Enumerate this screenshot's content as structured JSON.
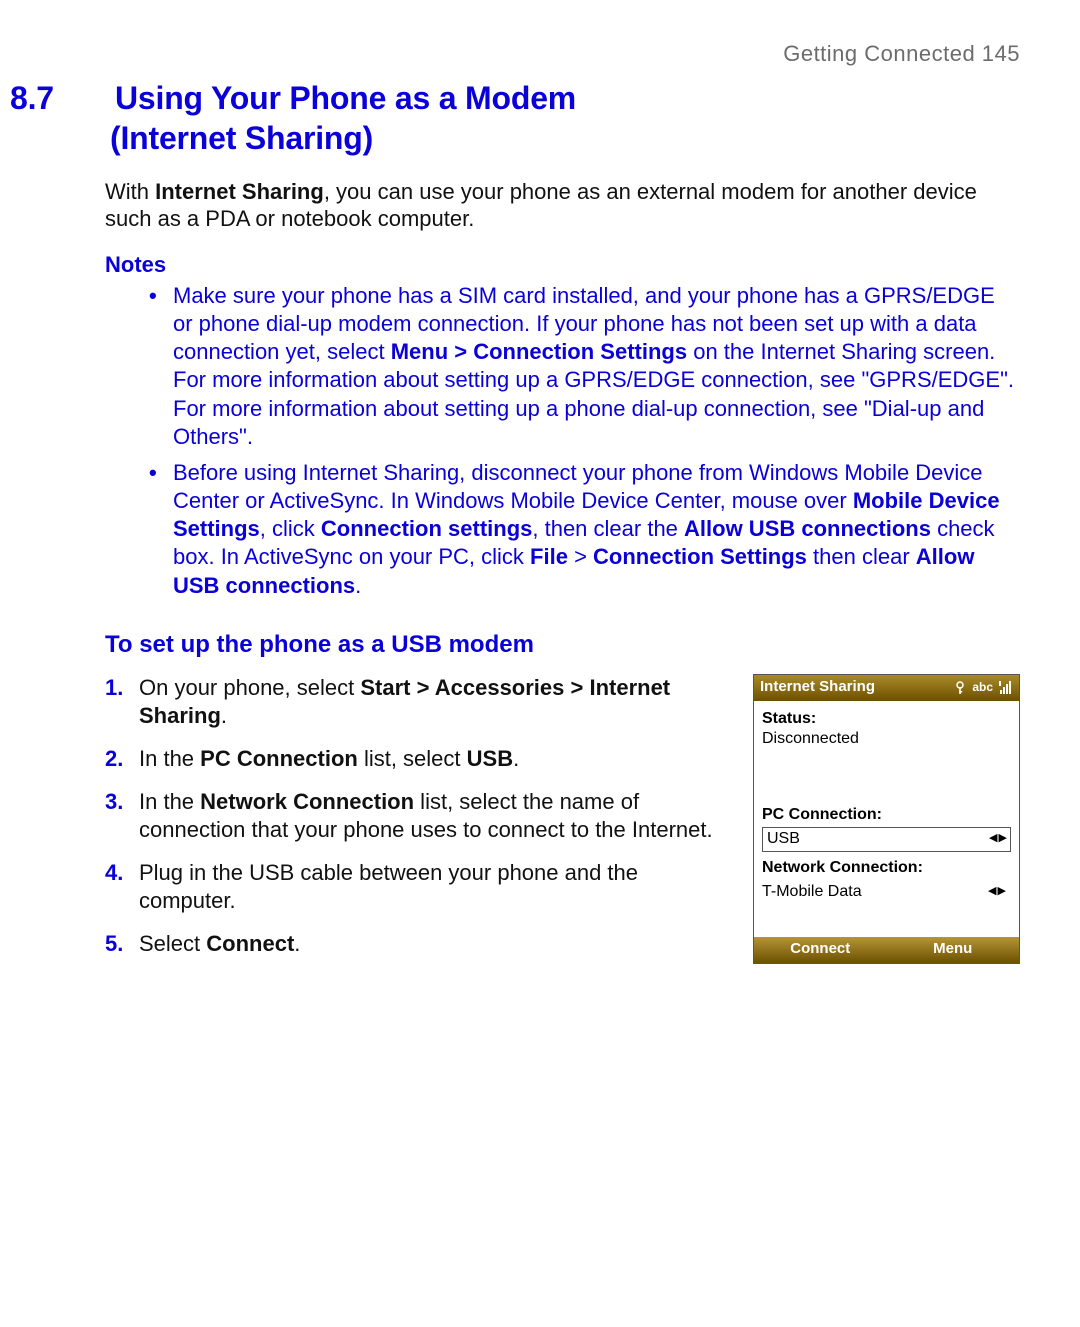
{
  "running_head": "Getting Connected  145",
  "section_number": "8.7",
  "section_title_l1": "Using Your Phone as a Modem",
  "section_title_l2": "(Internet Sharing)",
  "intro_pre": "With ",
  "intro_bold": "Internet Sharing",
  "intro_post": ", you can use your phone as an external modem for another device such as a PDA or notebook computer.",
  "notes_heading": "Notes",
  "notes": {
    "n1": {
      "p1": "Make sure your phone has a SIM card installed, and your phone has a GPRS/EDGE or phone dial-up modem connection. If your phone has not been set up with a data connection yet, select ",
      "b1": "Menu > Connection Settings",
      "p2": " on the Internet Sharing screen. For more information about setting up a GPRS/EDGE connection, see \"GPRS/EDGE\". For more information about setting up a phone dial-up connection, see \"Dial-up and Others\"."
    },
    "n2": {
      "p1": "Before using Internet Sharing, disconnect your phone from Windows Mobile Device Center or ActiveSync. In Windows Mobile Device Center, mouse over ",
      "b1": "Mobile Device Settings",
      "p2": ", click ",
      "b2": "Connection settings",
      "p3": ", then clear the ",
      "b3": "Allow USB connections",
      "p4": " check box. In ActiveSync on your PC, click ",
      "b4": "File",
      "p5": " > ",
      "b5": "Connection Settings",
      "p6": " then clear ",
      "b6": "Allow USB connections",
      "p7": "."
    }
  },
  "sub_heading": "To set up the phone as a USB modem",
  "steps": {
    "s1": {
      "p1": "On your phone, select ",
      "b1": "Start > Accessories > Internet Sharing",
      "p2": "."
    },
    "s2": {
      "p1": "In the ",
      "b1": "PC Connection",
      "p2": " list, select ",
      "b2": "USB",
      "p3": "."
    },
    "s3": {
      "p1": "In the ",
      "b1": "Network Connection",
      "p2": " list, select the name of connection that your phone uses to connect to the Internet."
    },
    "s4": {
      "p1": "Plug in the USB cable between your phone and the computer."
    },
    "s5": {
      "p1": "Select ",
      "b1": "Connect",
      "p2": "."
    }
  },
  "shot": {
    "title": "Internet Sharing",
    "abc": "abc",
    "status_label": "Status:",
    "status_value": "Disconnected",
    "pc_label": "PC Connection:",
    "pc_value": "USB",
    "net_label": "Network Connection:",
    "net_value": "T-Mobile Data",
    "sk_left": "Connect",
    "sk_right": "Menu"
  }
}
